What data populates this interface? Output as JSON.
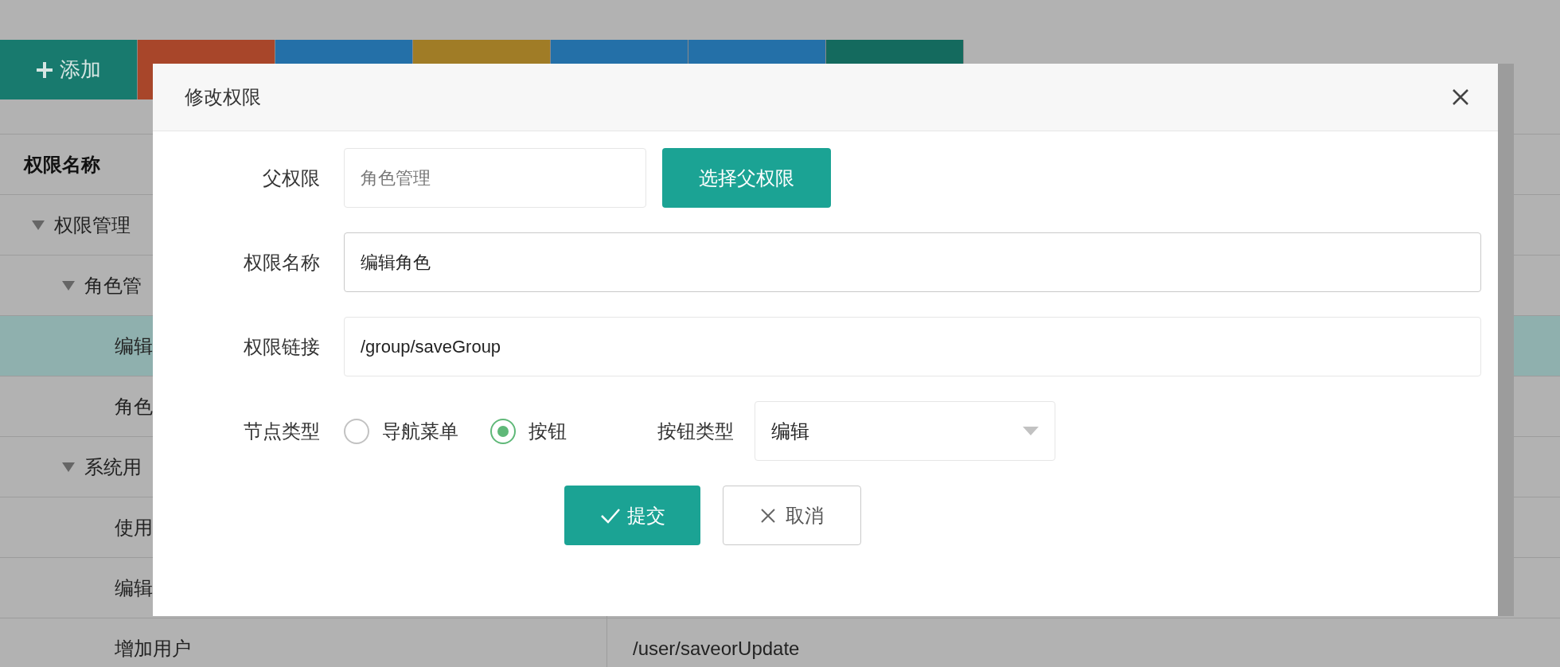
{
  "toolbar": [
    {
      "label": "添加",
      "color": "#187a6e"
    },
    {
      "color": "#a8462a"
    },
    {
      "color": "#2470a8"
    },
    {
      "color": "#a07c26"
    },
    {
      "color": "#2470a8"
    },
    {
      "color": "#2470a8"
    },
    {
      "color": "#146a5e"
    }
  ],
  "table": {
    "columns": [
      "权限名称"
    ],
    "rows": [
      {
        "name": "权限管理",
        "selected": false,
        "expanded": true,
        "children": [
          {
            "name": "角色管",
            "selected": false,
            "expanded": true,
            "children": [
              {
                "name": "编辑",
                "selected": true
              },
              {
                "name": "角色",
                "selected": false
              }
            ]
          },
          {
            "name": "系统用",
            "selected": false,
            "expanded": true,
            "children": [
              {
                "name": "使用",
                "selected": false
              },
              {
                "name": "编辑",
                "selected": false
              },
              {
                "name": "增加用户",
                "selected": false,
                "column_2": "/user/saveorUpdate"
              }
            ]
          }
        ]
      }
    ]
  },
  "dialog": {
    "title": "修改权限",
    "parent": {
      "label": "父权限",
      "placeholder": "角色管理",
      "button": "选择父权限"
    },
    "name": {
      "label": "权限名称",
      "value": "编辑角色"
    },
    "link": {
      "label": "权限链接",
      "value": "/group/saveGroup"
    },
    "node_type": {
      "label": "节点类型",
      "options": [
        {
          "label": "导航菜单",
          "selected": false
        },
        {
          "label": "按钮",
          "selected": true
        }
      ]
    },
    "button_type": {
      "label": "按钮类型",
      "value": "编辑"
    },
    "buttons": [
      {
        "kind": "submit",
        "label": "提交"
      },
      {
        "kind": "cancel",
        "label": "取消"
      }
    ]
  }
}
